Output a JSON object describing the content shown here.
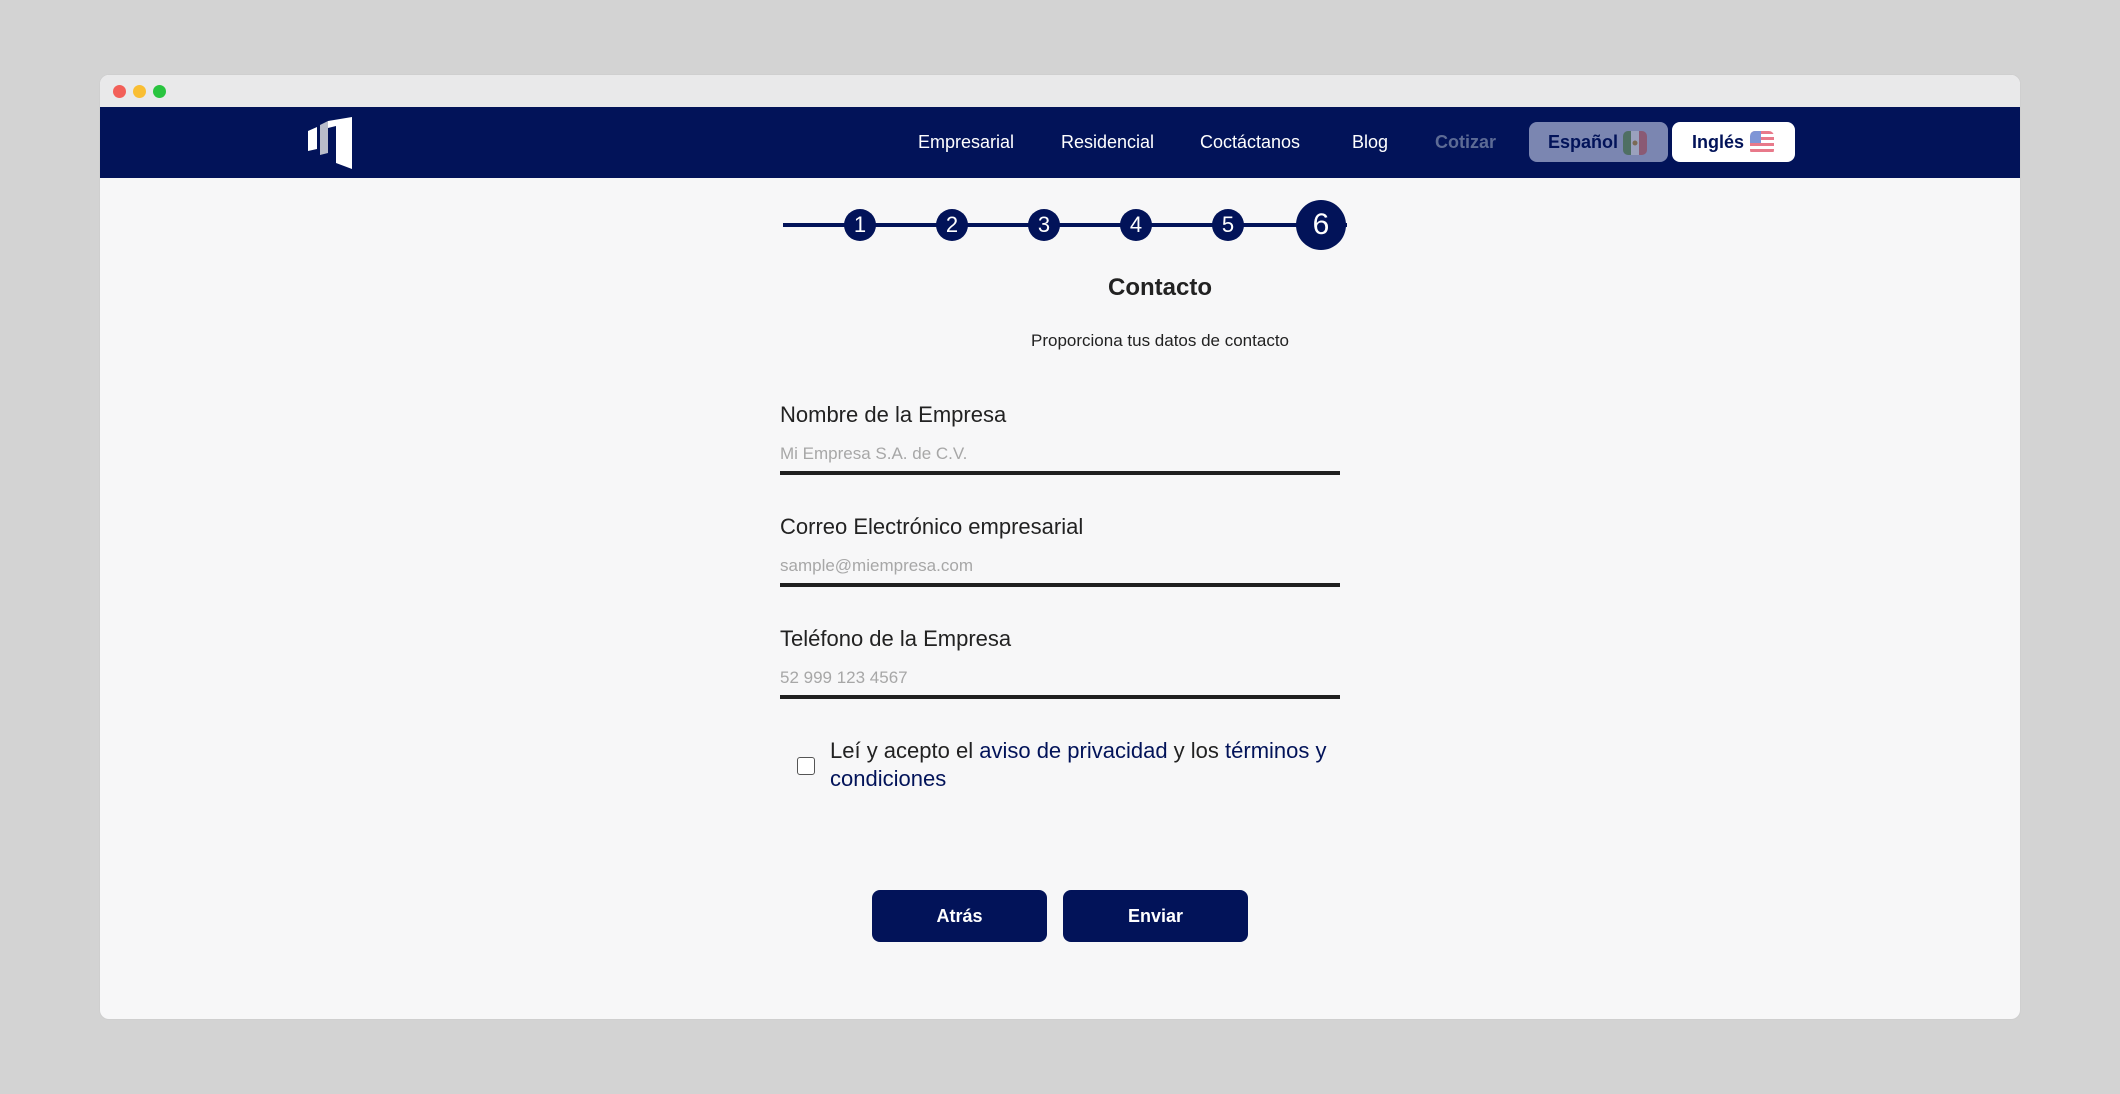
{
  "navbar": {
    "logo_name": "building-logo-icon",
    "links": [
      "Empresarial",
      "Residencial",
      "Coctáctanos",
      "Blog",
      "Cotizar"
    ],
    "languages": {
      "spanish": {
        "label": "Español",
        "flag": "mexico-flag-icon"
      },
      "english": {
        "label": "Inglés",
        "flag": "usa-flag-icon"
      }
    }
  },
  "stepper": {
    "steps": [
      "1",
      "2",
      "3",
      "4",
      "5",
      "6"
    ],
    "current_step": 6
  },
  "form": {
    "title": "Contacto",
    "subtitle": "Proporciona tus datos de contacto",
    "company_name": {
      "label": "Nombre de la Empresa",
      "placeholder": "Mi Empresa S.A. de C.V.",
      "value": ""
    },
    "email": {
      "label": "Correo Electrónico empresarial",
      "placeholder": "sample@miempresa.com",
      "value": ""
    },
    "phone": {
      "label": "Teléfono de la Empresa",
      "placeholder": "52 999 123 4567",
      "value": ""
    },
    "consent": {
      "checked": false,
      "prefix": "Leí y acepto el ",
      "privacy_link": "aviso de privacidad",
      "middle": " y los ",
      "terms_link": "términos y condiciones"
    },
    "buttons": {
      "back": "Atrás",
      "submit": "Enviar"
    }
  },
  "colors": {
    "brand_navy": "#021359",
    "page_background": "#f7f7f8",
    "outer_background": "#d3d3d3",
    "text": "#222222",
    "placeholder": "#a7a7a7"
  }
}
